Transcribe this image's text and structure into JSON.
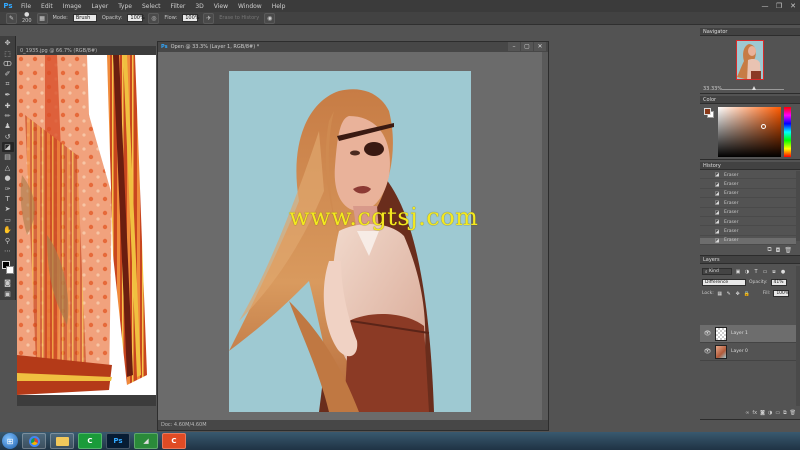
{
  "menubar": {
    "logo": "Ps",
    "items": [
      "File",
      "Edit",
      "Image",
      "Layer",
      "Type",
      "Select",
      "Filter",
      "3D",
      "View",
      "Window",
      "Help"
    ],
    "minimize": "—",
    "restore": "❐",
    "close": "✕"
  },
  "options": {
    "brush_size": "200",
    "mode_label": "Mode:",
    "mode_value": "Brush",
    "opacity_label": "Opacity:",
    "opacity_value": "100%",
    "flow_label": "Flow:",
    "flow_value": "100%",
    "erase_history_label": "Erase to History"
  },
  "doc1": {
    "tab_title": "0_1935.jpg @ 66.7% (RGB/8#)"
  },
  "doc2": {
    "title": "Open @ 33.3% (Layer 1, RGB/8#) *",
    "status": "Doc: 4.60M/4.60M"
  },
  "watermark": "www.cgtsj.com",
  "navigator": {
    "title": "Navigator",
    "zoom": "33.33%"
  },
  "color_panel": {
    "title": "Color",
    "fg": "#8a3a1a",
    "bg": "#ffffff"
  },
  "history": {
    "title": "History",
    "rows": [
      "Eraser",
      "Eraser",
      "Eraser",
      "Eraser",
      "Eraser",
      "Eraser",
      "Eraser",
      "Eraser"
    ]
  },
  "layers": {
    "title": "Layers",
    "filter_kind": "Kind",
    "blend_mode": "Difference",
    "opacity_label": "Opacity:",
    "opacity_value": "41%",
    "lock_label": "Lock:",
    "fill_label": "Fill:",
    "fill_value": "100%",
    "items": [
      {
        "name": "Layer 1",
        "selected": true
      },
      {
        "name": "Layer 0",
        "selected": false
      }
    ]
  },
  "taskbar": {
    "start_icon": "start-orb-icon",
    "apps": [
      "chrome-icon",
      "folder-icon",
      "camtasia-icon",
      "photoshop-icon",
      "green-app-icon",
      "c-app-icon"
    ]
  }
}
